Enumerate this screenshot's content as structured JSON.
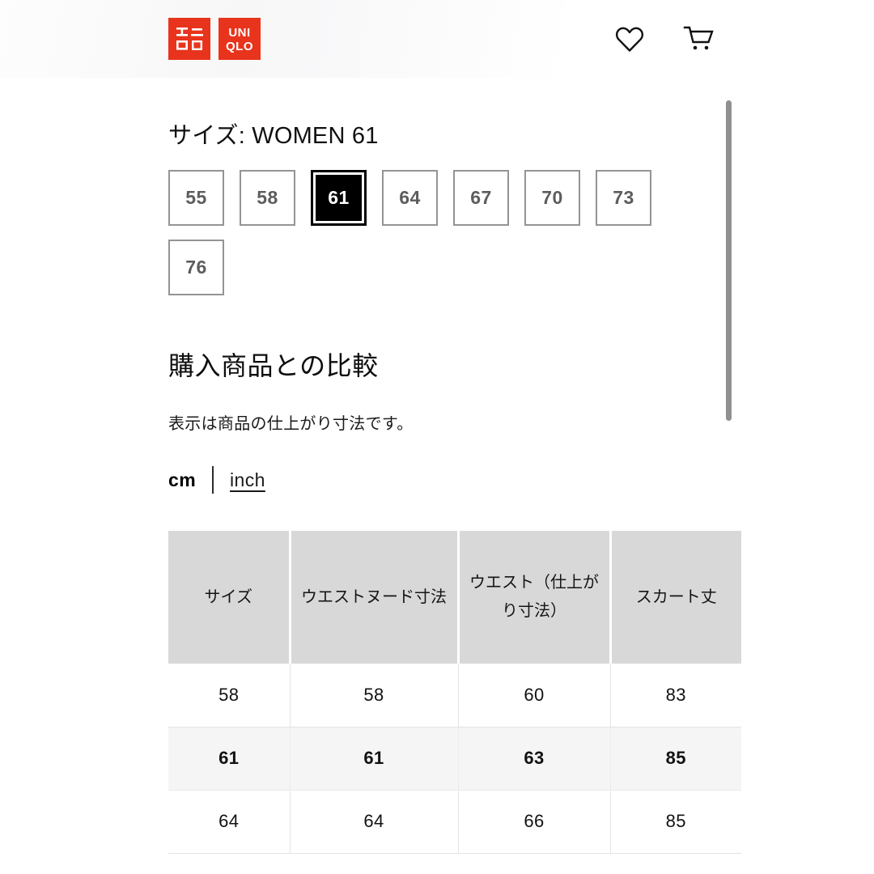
{
  "header": {
    "logo": {
      "icon": "uniqlo-logo",
      "jp_line1": "ユニ",
      "jp_line2": "クロ",
      "en_line1": "UNI",
      "en_line2": "QLO",
      "color": "#e8341c"
    },
    "wishlist_icon": "heart-icon",
    "cart_icon": "shopping-cart-icon"
  },
  "size_selector": {
    "title": "サイズ: WOMEN 61",
    "selected": "61",
    "options": [
      "55",
      "58",
      "61",
      "64",
      "67",
      "70",
      "73",
      "76"
    ]
  },
  "comparison": {
    "heading": "購入商品との比較",
    "description": "表示は商品の仕上がり寸法です。",
    "units": {
      "active": "cm",
      "inactive": "inch"
    }
  },
  "size_table": {
    "headers": [
      "サイズ",
      "ウエストヌード寸法",
      "ウエスト（仕上がり寸法）",
      "スカート丈"
    ],
    "rows": [
      {
        "highlight": false,
        "cells": [
          "58",
          "58",
          "60",
          "83"
        ]
      },
      {
        "highlight": true,
        "cells": [
          "61",
          "61",
          "63",
          "85"
        ]
      },
      {
        "highlight": false,
        "cells": [
          "64",
          "64",
          "66",
          "85"
        ]
      }
    ]
  },
  "scrollbar": {
    "name": "vertical-scrollbar",
    "color": "#909090"
  }
}
